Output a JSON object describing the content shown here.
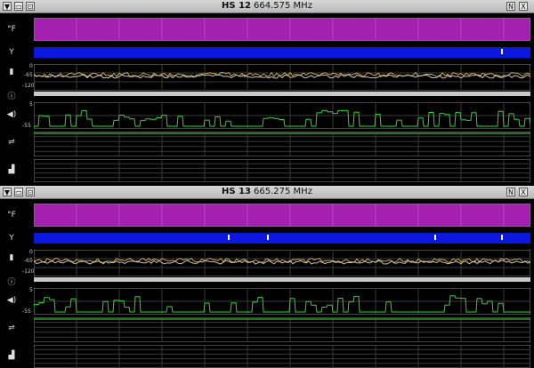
{
  "panels": [
    {
      "name": "HS 12",
      "frequency": "664.575 MHz",
      "icons": {
        "temp": "°F",
        "battery": "Y",
        "rf": "rf-meter",
        "info": "ⓘ",
        "audio": "◀)",
        "link": "⇌",
        "antenna": "▟"
      },
      "scales": {
        "rf_top": "0",
        "rf_mid": "-65",
        "rf_bot": "-120",
        "audio_top": "5",
        "audio_bot": "-55"
      }
    },
    {
      "name": "HS 13",
      "frequency": "665.275 MHz",
      "icons": {
        "temp": "°F",
        "battery": "Y",
        "rf": "rf-meter",
        "info": "ⓘ",
        "audio": "◀)",
        "link": "⇌",
        "antenna": "▟"
      },
      "scales": {
        "rf_top": "0",
        "rf_mid": "-65",
        "rf_bot": "-120",
        "audio_top": "5",
        "audio_bot": "-55"
      }
    }
  ],
  "titlebar_buttons": {
    "menu": "▼",
    "minimize": "▭",
    "restore": "⊡",
    "pin": "N",
    "close": "X"
  },
  "colors": {
    "temp_fill": "#a21fb0",
    "battery_fill": "#0a18e0",
    "rf_trace_a": "#d4a64a",
    "rf_trace_b": "#c8c8b8",
    "audio_trace": "#2fd62f",
    "grid": "#3a3a3a"
  }
}
